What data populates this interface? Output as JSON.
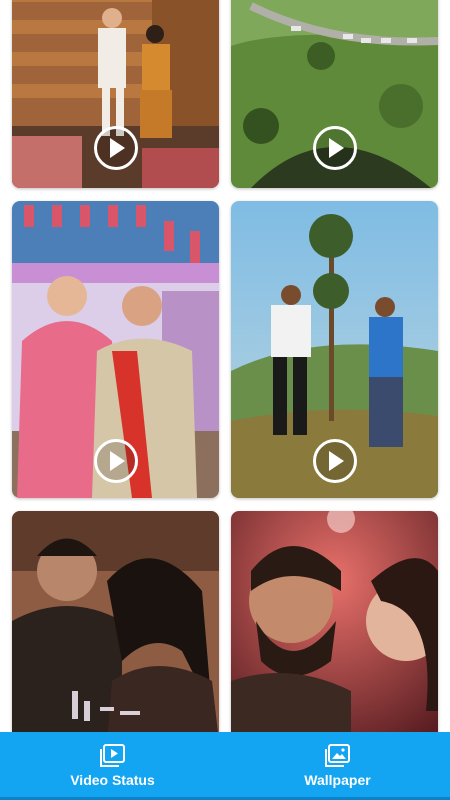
{
  "feed": {
    "items": [
      {
        "kind": "video",
        "scene": "couple-dancing-wooden-room"
      },
      {
        "kind": "video",
        "scene": "hillside-road-with-cars"
      },
      {
        "kind": "video",
        "scene": "two-women-pink-house"
      },
      {
        "kind": "video",
        "scene": "couple-dancing-hills"
      },
      {
        "kind": "video",
        "scene": "couple-laughing-portrait"
      },
      {
        "kind": "video",
        "scene": "couple-closeup-red-bokeh"
      }
    ]
  },
  "bottom_nav": {
    "background": "#13a4f2",
    "tabs": [
      {
        "label": "Video Status",
        "icon": "video-library-icon"
      },
      {
        "label": "Wallpaper",
        "icon": "image-gallery-icon"
      }
    ]
  }
}
